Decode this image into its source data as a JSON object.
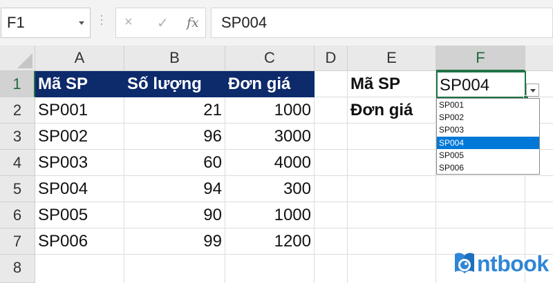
{
  "formula_bar": {
    "name_box": "F1",
    "cancel_icon": "×",
    "enter_icon": "✓",
    "fx_label": "fx",
    "formula_value": "SP004"
  },
  "columns": [
    "A",
    "B",
    "C",
    "D",
    "E",
    "F"
  ],
  "rows": [
    "1",
    "2",
    "3",
    "4",
    "5",
    "6",
    "7",
    "8"
  ],
  "table": {
    "header": [
      "Mã SP",
      "Số lượng",
      "Đơn giá"
    ],
    "data": [
      [
        "SP001",
        "21",
        "1000"
      ],
      [
        "SP002",
        "96",
        "3000"
      ],
      [
        "SP003",
        "60",
        "4000"
      ],
      [
        "SP004",
        "94",
        "300"
      ],
      [
        "SP005",
        "90",
        "1000"
      ],
      [
        "SP006",
        "99",
        "1200"
      ]
    ]
  },
  "lookup": {
    "label_code": "Mã SP",
    "label_price": "Đơn giá",
    "selected_value": "SP004"
  },
  "dropdown_options": [
    "SP001",
    "SP002",
    "SP003",
    "SP004",
    "SP005",
    "SP006"
  ],
  "logo": {
    "text": "ntbook"
  },
  "colors": {
    "header_fill": "#0d2a6b",
    "selection_green": "#217346",
    "dropdown_highlight": "#0078d7",
    "logo_blue": "#2f86d6"
  }
}
